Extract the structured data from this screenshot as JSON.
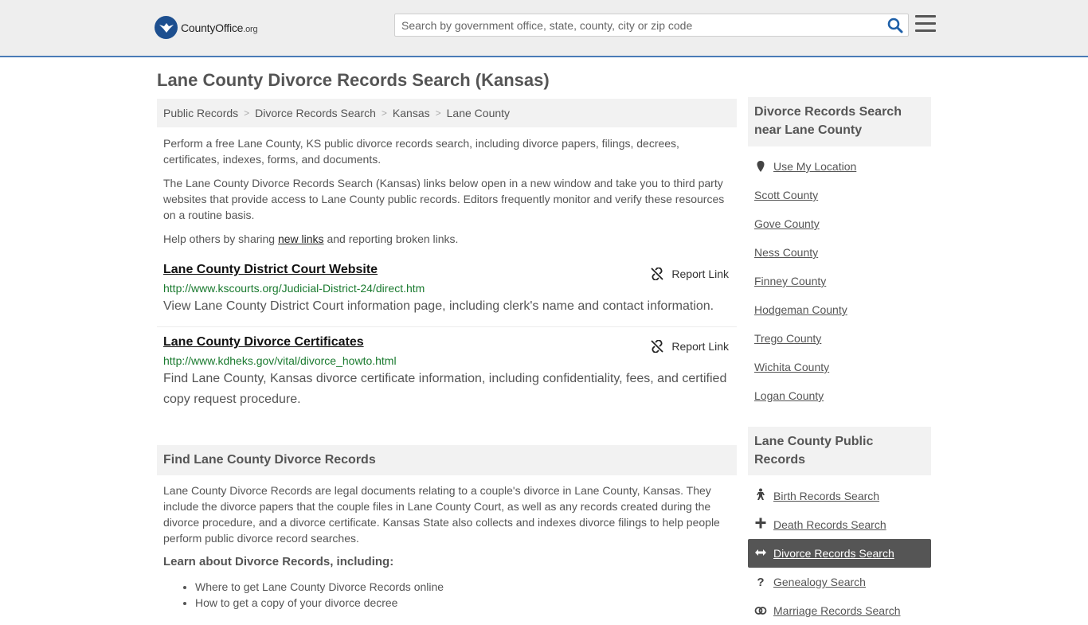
{
  "header": {
    "logo_brand": "CountyOffice",
    "logo_tld": ".org",
    "search_placeholder": "Search by government office, state, county, city or zip code"
  },
  "page": {
    "title": "Lane County Divorce Records Search (Kansas)"
  },
  "breadcrumb": [
    "Public Records",
    "Divorce Records Search",
    "Kansas",
    "Lane County"
  ],
  "intro": {
    "p1": "Perform a free Lane County, KS public divorce records search, including divorce papers, filings, decrees, certificates, indexes, forms, and documents.",
    "p2": "The Lane County Divorce Records Search (Kansas) links below open in a new window and take you to third party websites that provide access to Lane County public records. Editors frequently monitor and verify these resources on a routine basis.",
    "p3_before": "Help others by sharing ",
    "p3_link": "new links",
    "p3_after": " and reporting broken links."
  },
  "results": [
    {
      "title": "Lane County District Court Website",
      "url": "http://www.kscourts.org/Judicial-District-24/direct.htm",
      "desc": "View Lane County District Court information page, including clerk's name and contact information.",
      "report": "Report Link"
    },
    {
      "title": "Lane County Divorce Certificates",
      "url": "http://www.kdheks.gov/vital/divorce_howto.html",
      "desc": "Find Lane County, Kansas divorce certificate information, including confidentiality, fees, and certified copy request procedure.",
      "report": "Report Link"
    }
  ],
  "find_section": {
    "heading": "Find Lane County Divorce Records",
    "body": "Lane County Divorce Records are legal documents relating to a couple's divorce in Lane County, Kansas. They include the divorce papers that the couple files in Lane County Court, as well as any records created during the divorce procedure, and a divorce certificate. Kansas State also collects and indexes divorce filings to help people perform public divorce record searches.",
    "learn_heading": "Learn about Divorce Records, including:",
    "learn_items": [
      "Where to get Lane County Divorce Records online",
      "How to get a copy of your divorce decree"
    ]
  },
  "sidebar": {
    "nearby_heading": "Divorce Records Search near Lane County",
    "use_location": "Use My Location",
    "nearby": [
      "Scott County",
      "Gove County",
      "Ness County",
      "Finney County",
      "Hodgeman County",
      "Trego County",
      "Wichita County",
      "Logan County"
    ],
    "public_heading": "Lane County Public Records",
    "public_items": [
      {
        "label": "Birth Records Search",
        "icon": "person-icon"
      },
      {
        "label": "Death Records Search",
        "icon": "plus-icon"
      },
      {
        "label": "Divorce Records Search",
        "icon": "arrows-icon"
      },
      {
        "label": "Genealogy Search",
        "icon": "question-icon"
      },
      {
        "label": "Marriage Records Search",
        "icon": "rings-icon"
      }
    ]
  }
}
